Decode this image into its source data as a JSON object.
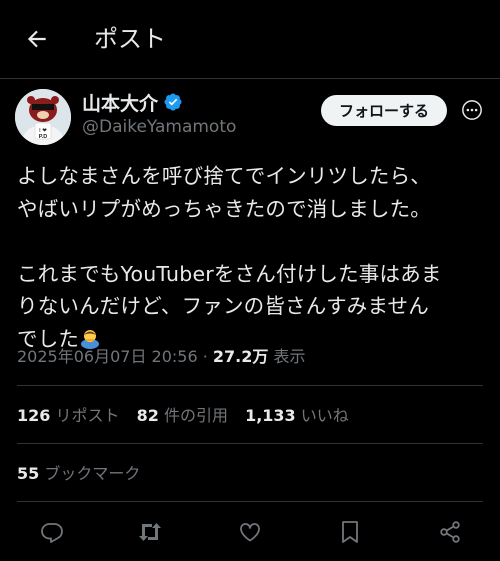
{
  "header": {
    "title": "ポスト"
  },
  "author": {
    "name": "山本大介",
    "handle": "@DaikeYamamoto",
    "verified": true,
    "avatar_text": "I ❤ P.D"
  },
  "follow_button": {
    "label": "フォローする"
  },
  "post": {
    "text_line1": "よしなまさんを呼び捨てでインリツしたら、",
    "text_line2": "やばいリプがめっちゃきたので消しました。",
    "text_line3": "これまでもYouTuberをさん付けした事はあま",
    "text_line4": "りないんだけど、ファンの皆さんすみません",
    "text_line5": "でした",
    "timestamp": "2025年06月07日 20:56",
    "separator": " · ",
    "views": "27.2万",
    "views_label": "表示"
  },
  "stats": {
    "reposts": "126",
    "reposts_label": "リポスト",
    "quotes": "82",
    "quotes_label": "件の引用",
    "likes": "1,133",
    "likes_label": "いいね",
    "bookmarks": "55",
    "bookmarks_label": "ブックマーク"
  },
  "icons": {
    "back": "arrow-left-icon",
    "verified": "verified-badge-icon",
    "more": "more-options-icon",
    "reply": "reply-icon",
    "repost": "repost-icon",
    "like": "heart-icon",
    "bookmark": "bookmark-icon",
    "share": "share-icon"
  },
  "colors": {
    "background": "#000000",
    "text": "#e7e9ea",
    "muted": "#71767b",
    "verified": "#1d9bf0",
    "divider": "#2f3336"
  }
}
